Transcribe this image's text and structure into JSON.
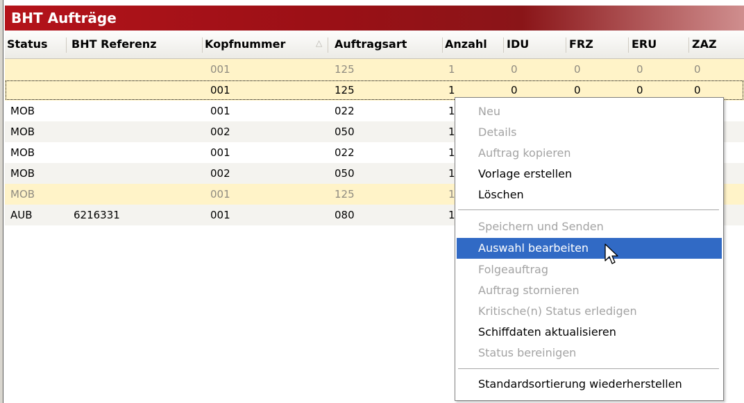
{
  "window": {
    "title": "BHT Aufträge"
  },
  "table": {
    "columns": [
      "Status",
      "BHT Referenz",
      "Kopfnummer",
      "Auftragsart",
      "Anzahl",
      "IDU",
      "FRZ",
      "ERU",
      "ZAZ"
    ],
    "sort": {
      "column": "Kopfnummer",
      "direction": "asc"
    },
    "rows": [
      {
        "status": "",
        "ref": "",
        "kopf": "001",
        "art": "125",
        "anzahl": "1",
        "idu": "0",
        "frz": "0",
        "eru": "0",
        "zaz": "0"
      },
      {
        "status": "",
        "ref": "",
        "kopf": "001",
        "art": "125",
        "anzahl": "1",
        "idu": "0",
        "frz": "0",
        "eru": "0",
        "zaz": "0"
      },
      {
        "status": "MOB",
        "ref": "",
        "kopf": "001",
        "art": "022",
        "anzahl": "1",
        "idu": "",
        "frz": "",
        "eru": "",
        "zaz": ""
      },
      {
        "status": "MOB",
        "ref": "",
        "kopf": "002",
        "art": "050",
        "anzahl": "1",
        "idu": "",
        "frz": "",
        "eru": "",
        "zaz": ""
      },
      {
        "status": "MOB",
        "ref": "",
        "kopf": "001",
        "art": "022",
        "anzahl": "1",
        "idu": "",
        "frz": "",
        "eru": "",
        "zaz": ""
      },
      {
        "status": "MOB",
        "ref": "",
        "kopf": "002",
        "art": "050",
        "anzahl": "1",
        "idu": "",
        "frz": "",
        "eru": "",
        "zaz": ""
      },
      {
        "status": "MOB",
        "ref": "",
        "kopf": "001",
        "art": "125",
        "anzahl": "1",
        "idu": "",
        "frz": "",
        "eru": "",
        "zaz": ""
      },
      {
        "status": "AUB",
        "ref": "6216331",
        "kopf": "001",
        "art": "080",
        "anzahl": "1",
        "idu": "",
        "frz": "",
        "eru": "",
        "zaz": ""
      }
    ]
  },
  "context_menu": {
    "items": [
      {
        "label": "Neu",
        "enabled": false
      },
      {
        "label": "Details",
        "enabled": false
      },
      {
        "label": "Auftrag kopieren",
        "enabled": false
      },
      {
        "label": "Vorlage erstellen",
        "enabled": true
      },
      {
        "label": "Löschen",
        "enabled": true
      },
      {
        "label": "Speichern und Senden",
        "enabled": false
      },
      {
        "label": "Auswahl bearbeiten",
        "enabled": true,
        "highlighted": true
      },
      {
        "label": "Folgeauftrag",
        "enabled": false
      },
      {
        "label": "Auftrag stornieren",
        "enabled": false
      },
      {
        "label": "Kritische(n) Status erledigen",
        "enabled": false
      },
      {
        "label": "Schiffdaten aktualisieren",
        "enabled": true
      },
      {
        "label": "Status bereinigen",
        "enabled": false
      },
      {
        "label": "Standardsortierung wiederherstellen",
        "enabled": true
      }
    ]
  },
  "colors": {
    "title_bar": "#9a1016",
    "highlight": "#316ac5",
    "row_yellow": "#fff3c8",
    "row_alt": "#f4f3ef",
    "disabled_text": "#a3a3a3"
  }
}
